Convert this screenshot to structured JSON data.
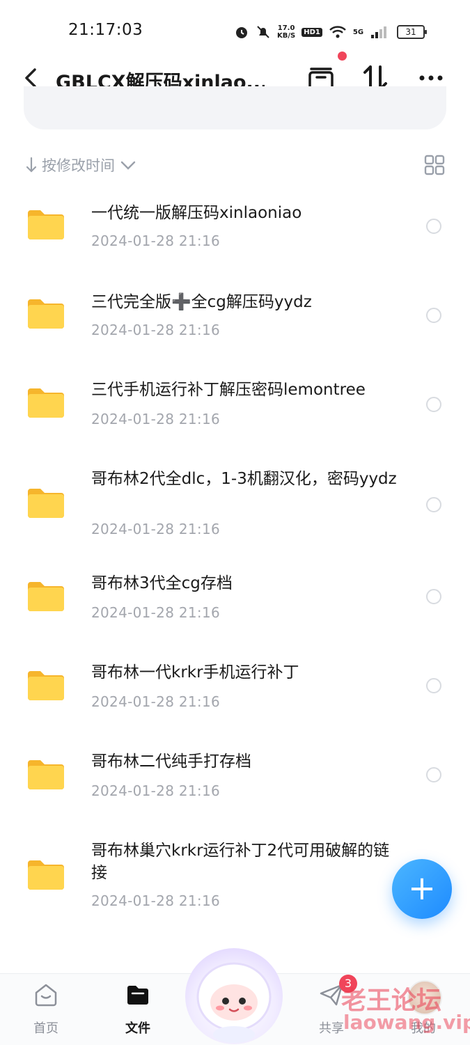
{
  "status_bar": {
    "time": "21:17:03",
    "speed_value": "17.0",
    "speed_unit": "KB/S",
    "hd_label": "HD1",
    "network_label": "5G",
    "battery": "31"
  },
  "header": {
    "title": "GBLCX解压码xinlao..."
  },
  "sort": {
    "label": "按修改时间"
  },
  "files": [
    {
      "name": "一代统一版解压码xinlaoniao",
      "date": "2024-01-28  21:16"
    },
    {
      "name": "三代完全版➕全cg解压码yydz",
      "date": "2024-01-28  21:16"
    },
    {
      "name": "三代手机运行补丁解压密码lemontree",
      "date": "2024-01-28  21:16"
    },
    {
      "name": "哥布林2代全dlc，1-3机翻汉化，密码yydz",
      "date": "2024-01-28  21:16"
    },
    {
      "name": "哥布林3代全cg存档",
      "date": "2024-01-28  21:16"
    },
    {
      "name": "哥布林一代krkr手机运行补丁",
      "date": "2024-01-28  21:16"
    },
    {
      "name": "哥布林二代纯手打存档",
      "date": "2024-01-28  21:16"
    },
    {
      "name": "哥布林巢穴krkr运行补丁2代可用破解的链接",
      "date": "2024-01-28  21:16"
    }
  ],
  "fab": {
    "icon": "plus-icon"
  },
  "bottom_nav": {
    "home_label": "首页",
    "files_label": "文件",
    "share_label": "共享",
    "share_badge": "3",
    "mine_label": "我的"
  },
  "watermark": {
    "line1": "老王论坛",
    "line2": "laowang.vip"
  },
  "colors": {
    "accent": "#1e8bff",
    "badge": "#f0455a",
    "folder": "#ffc83d"
  }
}
